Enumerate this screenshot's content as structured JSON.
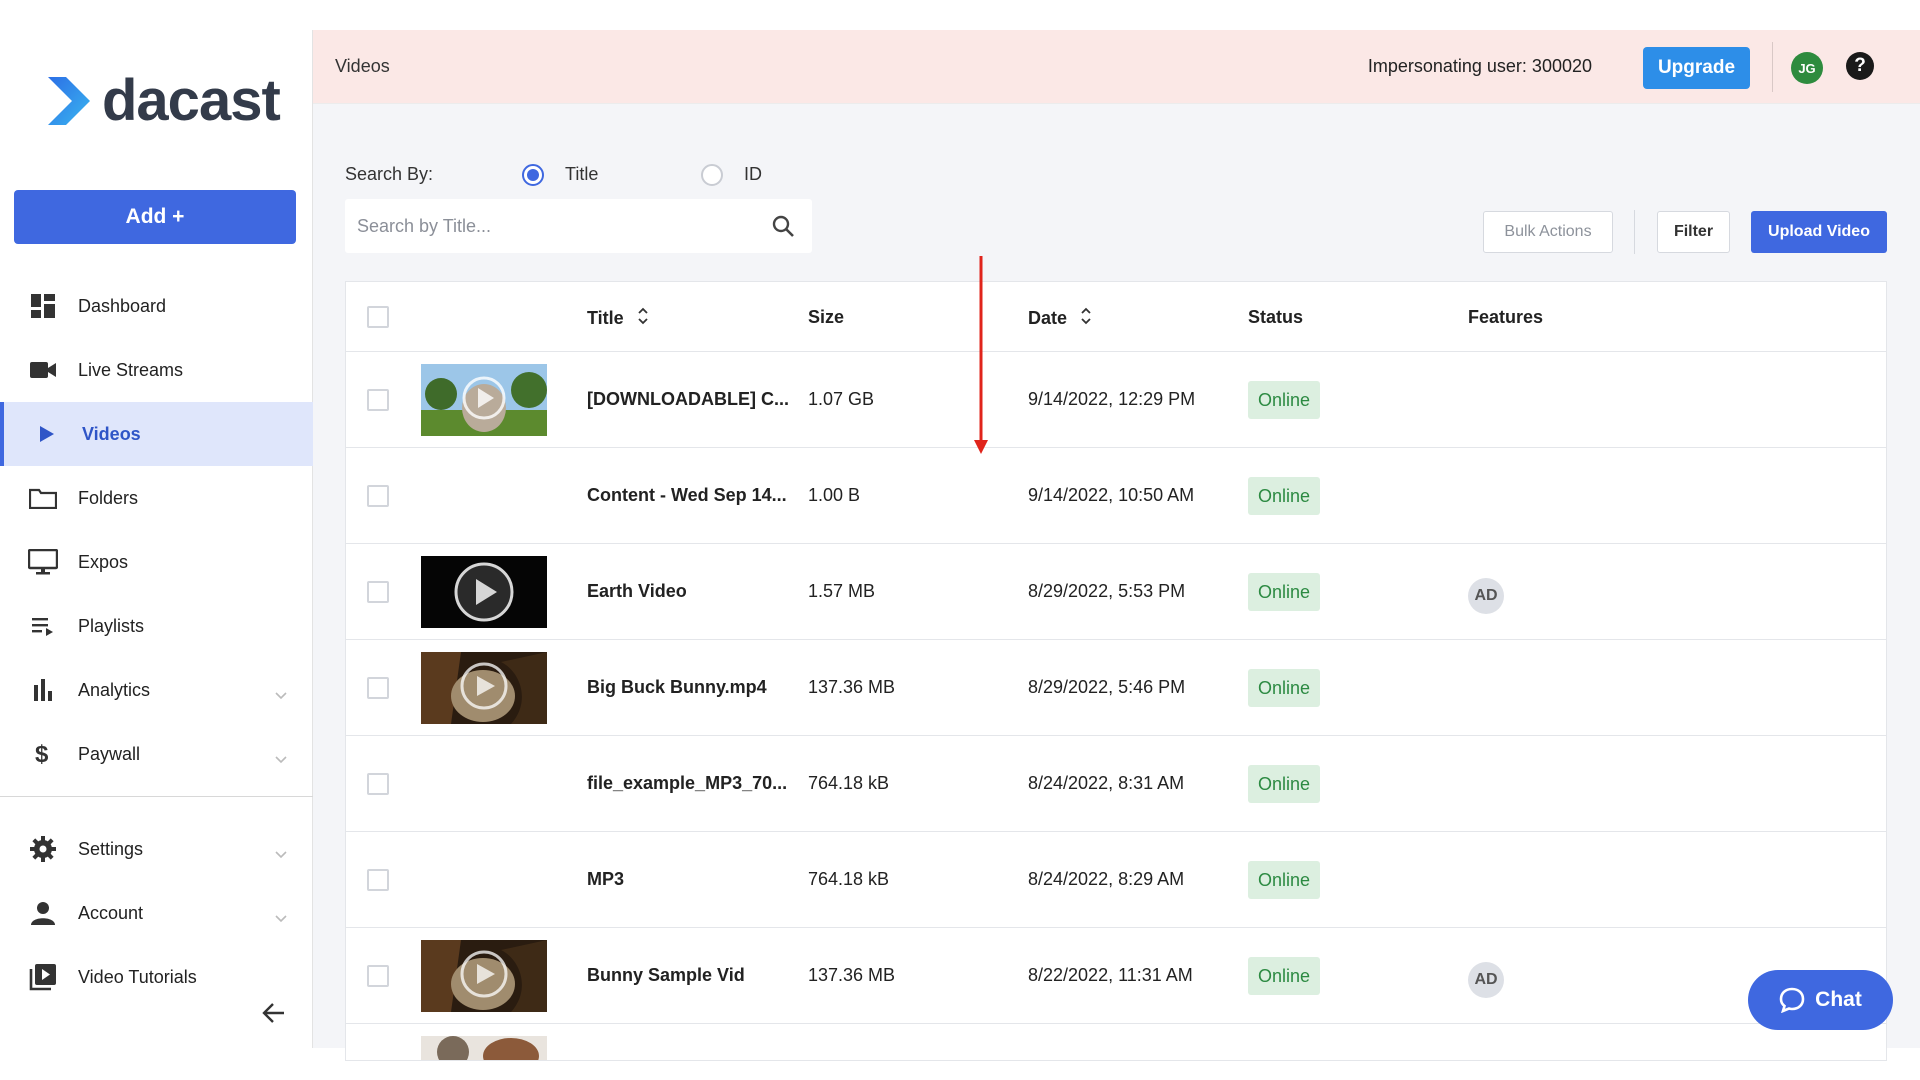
{
  "brand": {
    "name": "dacast",
    "accent": "#3f68e0"
  },
  "sidebar": {
    "add_label": "Add +",
    "items": [
      {
        "label": "Dashboard",
        "icon": "dashboard-icon"
      },
      {
        "label": "Live Streams",
        "icon": "camera-icon"
      },
      {
        "label": "Videos",
        "icon": "play-icon",
        "active": true
      },
      {
        "label": "Folders",
        "icon": "folder-icon"
      },
      {
        "label": "Expos",
        "icon": "monitor-icon"
      },
      {
        "label": "Playlists",
        "icon": "playlist-icon"
      },
      {
        "label": "Analytics",
        "icon": "bar-chart-icon",
        "expandable": true
      },
      {
        "label": "Paywall",
        "icon": "dollar-icon",
        "expandable": true
      }
    ],
    "bottom_items": [
      {
        "label": "Settings",
        "icon": "gear-icon",
        "expandable": true
      },
      {
        "label": "Account",
        "icon": "person-icon",
        "expandable": true
      },
      {
        "label": "Video Tutorials",
        "icon": "video-library-icon"
      }
    ]
  },
  "topbar": {
    "title": "Videos",
    "impersonating": "Impersonating user: 300020",
    "upgrade_label": "Upgrade",
    "avatar_initials": "JG",
    "help_label": "?"
  },
  "search": {
    "by_label": "Search By:",
    "option_title": "Title",
    "option_id": "ID",
    "placeholder": "Search by Title...",
    "value": ""
  },
  "toolbar": {
    "bulk_label": "Bulk Actions",
    "filter_label": "Filter",
    "upload_label": "Upload Video"
  },
  "table": {
    "headers": {
      "title": "Title",
      "size": "Size",
      "date": "Date",
      "status": "Status",
      "features": "Features"
    },
    "rows": [
      {
        "title": "[DOWNLOADABLE] C...",
        "size": "1.07 GB",
        "date": "9/14/2022, 12:29 PM",
        "status": "Online",
        "feature": "",
        "thumb": "landscape"
      },
      {
        "title": "Content - Wed Sep 14...",
        "size": "1.00 B",
        "date": "9/14/2022, 10:50 AM",
        "status": "Online",
        "feature": "",
        "thumb": "none"
      },
      {
        "title": "Earth Video",
        "size": "1.57 MB",
        "date": "8/29/2022, 5:53 PM",
        "status": "Online",
        "feature": "AD",
        "thumb": "dark"
      },
      {
        "title": "Big Buck Bunny.mp4",
        "size": "137.36 MB",
        "date": "8/29/2022, 5:46 PM",
        "status": "Online",
        "feature": "",
        "thumb": "bunny"
      },
      {
        "title": "file_example_MP3_70...",
        "size": "764.18 kB",
        "date": "8/24/2022, 8:31 AM",
        "status": "Online",
        "feature": "",
        "thumb": "none"
      },
      {
        "title": "MP3",
        "size": "764.18 kB",
        "date": "8/24/2022, 8:29 AM",
        "status": "Online",
        "feature": "",
        "thumb": "none"
      },
      {
        "title": "Bunny Sample Vid",
        "size": "137.36 MB",
        "date": "8/22/2022, 11:31 AM",
        "status": "Online",
        "feature": "AD",
        "thumb": "bunny"
      }
    ]
  },
  "chat": {
    "label": "Chat"
  }
}
